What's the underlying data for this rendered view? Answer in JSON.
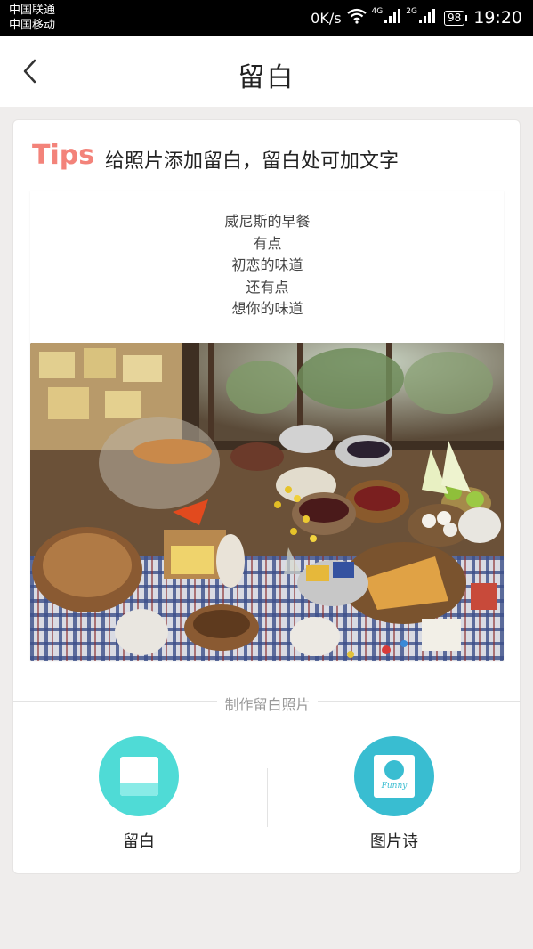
{
  "status_bar": {
    "carrier_1": "中国联通",
    "carrier_2": "中国移动",
    "network_speed": "0K/s",
    "net_type_1": "4G",
    "net_type_2": "2G",
    "battery": "98",
    "time": "19:20",
    "icons": [
      "wifi-icon",
      "signal-icon",
      "battery-icon"
    ]
  },
  "header": {
    "title": "留白",
    "back_icon": "chevron-left-icon"
  },
  "tips": {
    "label": "Tips",
    "text": "给照片添加留白，留白处可加文字"
  },
  "preview": {
    "poem_lines": [
      "威尼斯的早餐",
      "有点",
      "初恋的味道",
      "还有点",
      "想你的味道"
    ]
  },
  "section_divider": "制作留白照片",
  "actions": [
    {
      "label": "留白",
      "icon": "blank-frame-icon",
      "color": "#4fdbd6"
    },
    {
      "label": "图片诗",
      "icon": "picture-poem-icon",
      "color": "#39bdd1",
      "icon_text": "Funny"
    }
  ],
  "colors": {
    "accent": "#f3837a",
    "teal_light": "#4fdbd6",
    "teal_dark": "#39bdd1"
  }
}
